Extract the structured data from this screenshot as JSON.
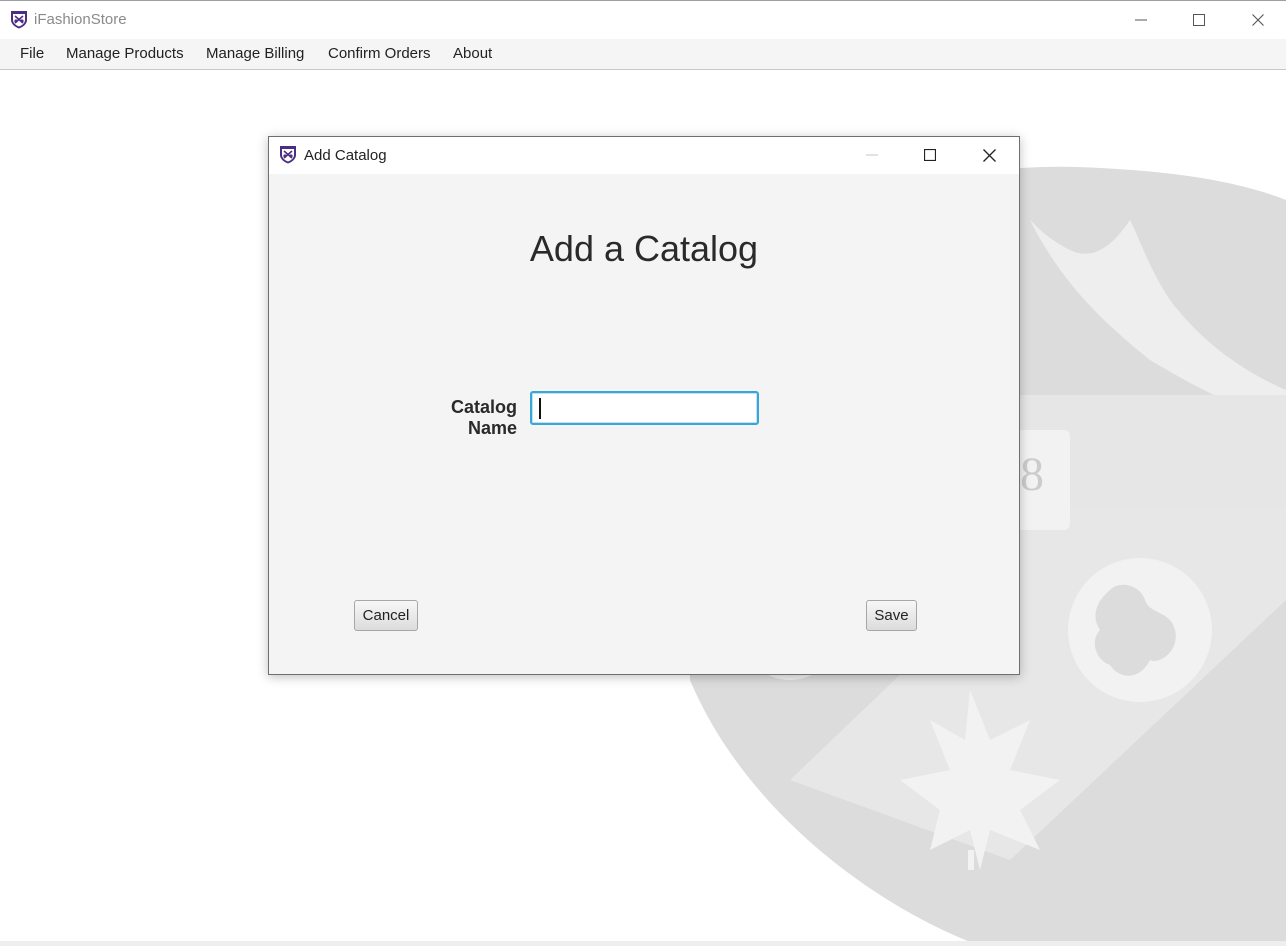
{
  "window": {
    "title": "iFashionStore",
    "controls": {
      "minimize": "minimize-icon",
      "maximize": "maximize-icon",
      "close": "close-icon"
    }
  },
  "menubar": {
    "items": [
      {
        "label": "File"
      },
      {
        "label": "Manage Products"
      },
      {
        "label": "Manage Billing"
      },
      {
        "label": "Confirm Orders"
      },
      {
        "label": "About"
      }
    ]
  },
  "dialog": {
    "title": "Add Catalog",
    "heading": "Add a Catalog",
    "field_label": "Catalog Name",
    "field_value": "",
    "field_placeholder": "",
    "cancel_label": "Cancel",
    "save_label": "Save"
  },
  "colors": {
    "focus_border": "#39a6d8",
    "logo_purple": "#4b2e83",
    "crest_gray": "#dcdcdc"
  }
}
